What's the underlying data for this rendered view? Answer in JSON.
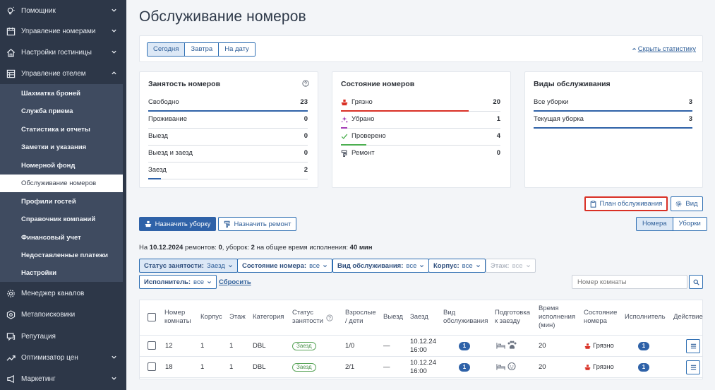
{
  "sidebar": {
    "top_items": [
      {
        "label": "Помощник",
        "icon": "lightbulb-icon"
      },
      {
        "label": "Управление номерами",
        "icon": "calendar-icon"
      },
      {
        "label": "Настройки гостиницы",
        "icon": "home-icon"
      },
      {
        "label": "Управление отелем",
        "icon": "grid-icon"
      }
    ],
    "sub_items": [
      {
        "label": "Шахматка броней"
      },
      {
        "label": "Служба приема"
      },
      {
        "label": "Статистика и отчеты"
      },
      {
        "label": "Заметки и указания"
      },
      {
        "label": "Номерной фонд"
      },
      {
        "label": "Обслуживание номеров",
        "active": true
      },
      {
        "label": "Профили гостей"
      },
      {
        "label": "Справочник компаний"
      },
      {
        "label": "Финансовый учет"
      },
      {
        "label": "Недоставленные платежи"
      },
      {
        "label": "Настройки"
      }
    ],
    "bottom_items": [
      {
        "label": "Менеджер каналов",
        "icon": "cog-icon"
      },
      {
        "label": "Метапоисковики",
        "icon": "search-icon"
      },
      {
        "label": "Репутация",
        "icon": "chat-icon"
      },
      {
        "label": "Оптимизатор цен",
        "icon": "trend-icon"
      },
      {
        "label": "Маркетинг",
        "icon": "megaphone-icon"
      }
    ]
  },
  "page": {
    "title": "Обслуживание номеров",
    "date_tabs": [
      "Сегодня",
      "Завтра",
      "На дату"
    ],
    "active_date_tab": "Сегодня",
    "hide_stats": "Скрыть статистику"
  },
  "occupancy": {
    "title": "Занятость номеров",
    "rows": [
      {
        "label": "Свободно",
        "value": "23",
        "fraction": 1.0
      },
      {
        "label": "Проживание",
        "value": "0",
        "fraction": 0
      },
      {
        "label": "Выезд",
        "value": "0",
        "fraction": 0
      },
      {
        "label": "Выезд и заезд",
        "value": "0",
        "fraction": 0
      },
      {
        "label": "Заезд",
        "value": "2",
        "fraction": 0.08
      }
    ]
  },
  "room_state": {
    "title": "Состояние номеров",
    "rows": [
      {
        "label": "Грязно",
        "value": "20",
        "icon": "dirty-icon",
        "color": "#d93025",
        "fraction": 0.8
      },
      {
        "label": "Убрано",
        "value": "1",
        "icon": "clean-icon",
        "color": "#a23bb5",
        "fraction": 0.04
      },
      {
        "label": "Проверено",
        "value": "4",
        "icon": "check-icon",
        "color": "#4caf50",
        "fraction": 0.16
      },
      {
        "label": "Ремонт",
        "value": "0",
        "icon": "repair-icon",
        "color": "#3a4150",
        "fraction": 0
      }
    ]
  },
  "service_types": {
    "title": "Виды обслуживания",
    "rows": [
      {
        "label": "Все уборки",
        "value": "3",
        "fraction": 1.0
      },
      {
        "label": "Текущая уборка",
        "value": "3",
        "fraction": 1.0
      }
    ]
  },
  "toolbar": {
    "plan": "План обслуживания",
    "view": "Вид",
    "assign_cleaning": "Назначить уборку",
    "assign_repair": "Назначить ремонт",
    "view_rooms": "Номера",
    "view_cleanings": "Уборки"
  },
  "summary": {
    "prefix": "На",
    "date": "10.12.2024",
    "repairs_text": "ремонтов:",
    "repairs": "0",
    "cleanings_text": ", уборок:",
    "cleanings": "2",
    "total_text": "на общее время исполнения:",
    "total": "40 мин"
  },
  "filters": [
    {
      "label": "Статус занятости:",
      "value": "Заезд",
      "active": true
    },
    {
      "label": "Состояние номера:",
      "value": "все"
    },
    {
      "label": "Вид обслуживания:",
      "value": "все"
    },
    {
      "label": "Корпус:",
      "value": "все"
    },
    {
      "label": "Этаж:",
      "value": "все",
      "disabled": true
    },
    {
      "label": "Исполнитель:",
      "value": "все"
    }
  ],
  "reset": "Сбросить",
  "room_search_placeholder": "Номер комнаты",
  "table": {
    "headers": {
      "room": "Номер комнаты",
      "building": "Корпус",
      "floor": "Этаж",
      "category": "Категория",
      "occ_status": "Статус занятости",
      "guests": "Взрослые / дети",
      "departure": "Выезд",
      "arrival": "Заезд",
      "service": "Вид обслуживания",
      "prep": "Подготовка к заезду",
      "time": "Время исполнения (мин)",
      "state": "Состояние номера",
      "executor": "Исполнитель",
      "action": "Действие"
    },
    "rows": [
      {
        "room": "12",
        "building": "1",
        "floor": "1",
        "category": "DBL",
        "status": "Заезд",
        "guests": "1/0",
        "departure": "—",
        "arrival_date": "10.12.24",
        "arrival_time": "16:00",
        "service": "1",
        "time": "20",
        "state": "Грязно",
        "executor": "1"
      },
      {
        "room": "18",
        "building": "1",
        "floor": "1",
        "category": "DBL",
        "status": "Заезд",
        "guests": "2/1",
        "departure": "—",
        "arrival_date": "10.12.24",
        "arrival_time": "16:00",
        "service": "1",
        "time": "20",
        "state": "Грязно",
        "executor": "1"
      }
    ]
  },
  "colors": {
    "accent": "#2f62a8",
    "sidebar": "#2d3748",
    "highlight": "#d93025"
  }
}
